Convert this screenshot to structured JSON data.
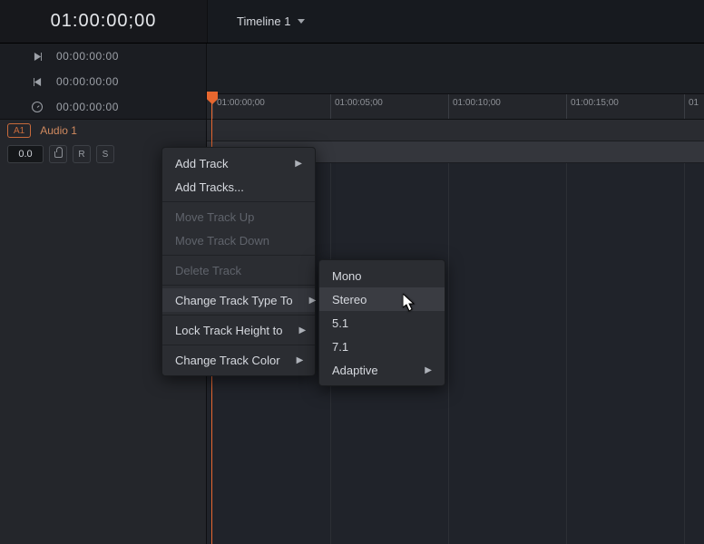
{
  "header": {
    "main_timecode": "01:00:00;00",
    "timeline_name": "Timeline 1"
  },
  "transport": {
    "play_tc": "00:00:00:00",
    "prev_tc": "00:00:00:00",
    "dur_tc": "00:00:00:00"
  },
  "ruler": {
    "ticks": [
      "01:00:00;00",
      "01:00:05;00",
      "01:00:10;00",
      "01:00:15;00",
      "01"
    ]
  },
  "track": {
    "id": "A1",
    "name": "Audio 1",
    "db": "0.0",
    "btn_r": "R",
    "btn_s": "S"
  },
  "context_menu": {
    "items": [
      {
        "label": "Add Track",
        "sub": true,
        "disabled": false
      },
      {
        "label": "Add Tracks...",
        "sub": false,
        "disabled": false
      },
      {
        "label": "Move Track Up",
        "sub": false,
        "disabled": true
      },
      {
        "label": "Move Track Down",
        "sub": false,
        "disabled": true
      },
      {
        "label": "Delete Track",
        "sub": false,
        "disabled": true
      },
      {
        "label": "Change Track Type To",
        "sub": true,
        "disabled": false,
        "hover": true
      },
      {
        "label": "Lock Track Height to",
        "sub": true,
        "disabled": false
      },
      {
        "label": "Change Track Color",
        "sub": true,
        "disabled": false
      }
    ]
  },
  "submenu": {
    "items": [
      {
        "label": "Mono",
        "sub": false
      },
      {
        "label": "Stereo",
        "sub": false,
        "hover": true
      },
      {
        "label": "5.1",
        "sub": false
      },
      {
        "label": "7.1",
        "sub": false
      },
      {
        "label": "Adaptive",
        "sub": true
      }
    ]
  }
}
